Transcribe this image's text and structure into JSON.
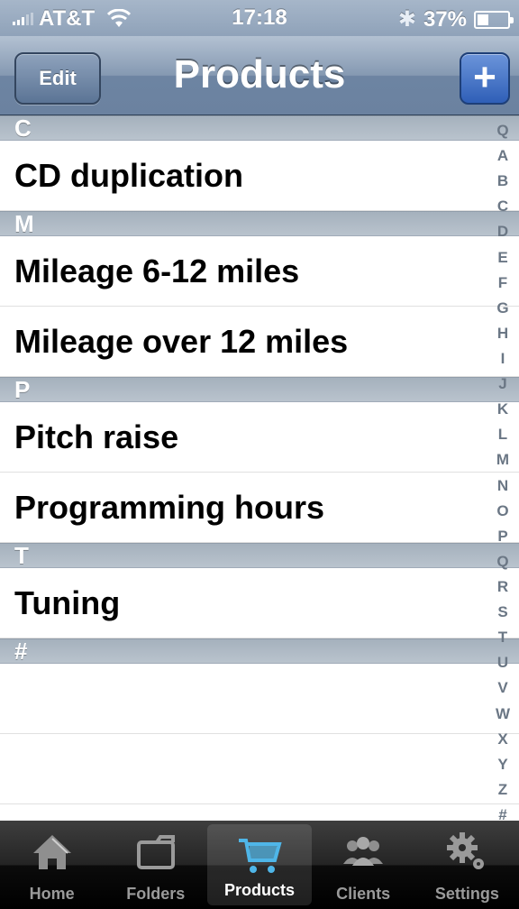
{
  "status_bar": {
    "carrier": "AT&T",
    "time": "17:18",
    "battery_percent_label": "37%",
    "battery_level": 0.37
  },
  "nav": {
    "edit_label": "Edit",
    "title": "Products",
    "add_label": "+"
  },
  "list": {
    "sections": [
      {
        "header": "C",
        "items": [
          "CD duplication"
        ]
      },
      {
        "header": "M",
        "items": [
          "Mileage 6-12 miles",
          "Mileage over 12 miles"
        ]
      },
      {
        "header": "P",
        "items": [
          "Pitch raise",
          "Programming hours"
        ]
      },
      {
        "header": "T",
        "items": [
          "Tuning"
        ]
      },
      {
        "header": "#",
        "items": []
      }
    ]
  },
  "index": [
    "Q",
    "A",
    "B",
    "C",
    "D",
    "E",
    "F",
    "G",
    "H",
    "I",
    "J",
    "K",
    "L",
    "M",
    "N",
    "O",
    "P",
    "Q",
    "R",
    "S",
    "T",
    "U",
    "V",
    "W",
    "X",
    "Y",
    "Z",
    "#"
  ],
  "tabs": [
    {
      "label": "Home",
      "icon": "home-icon",
      "active": false
    },
    {
      "label": "Folders",
      "icon": "folder-icon",
      "active": false
    },
    {
      "label": "Products",
      "icon": "cart-icon",
      "active": true
    },
    {
      "label": "Clients",
      "icon": "people-icon",
      "active": false
    },
    {
      "label": "Settings",
      "icon": "gear-icon",
      "active": false
    }
  ],
  "colors": {
    "nav_tint": "#6d84a2",
    "add_button": "#2f5fb7",
    "active_tab_icon": "#4fb6e8"
  }
}
